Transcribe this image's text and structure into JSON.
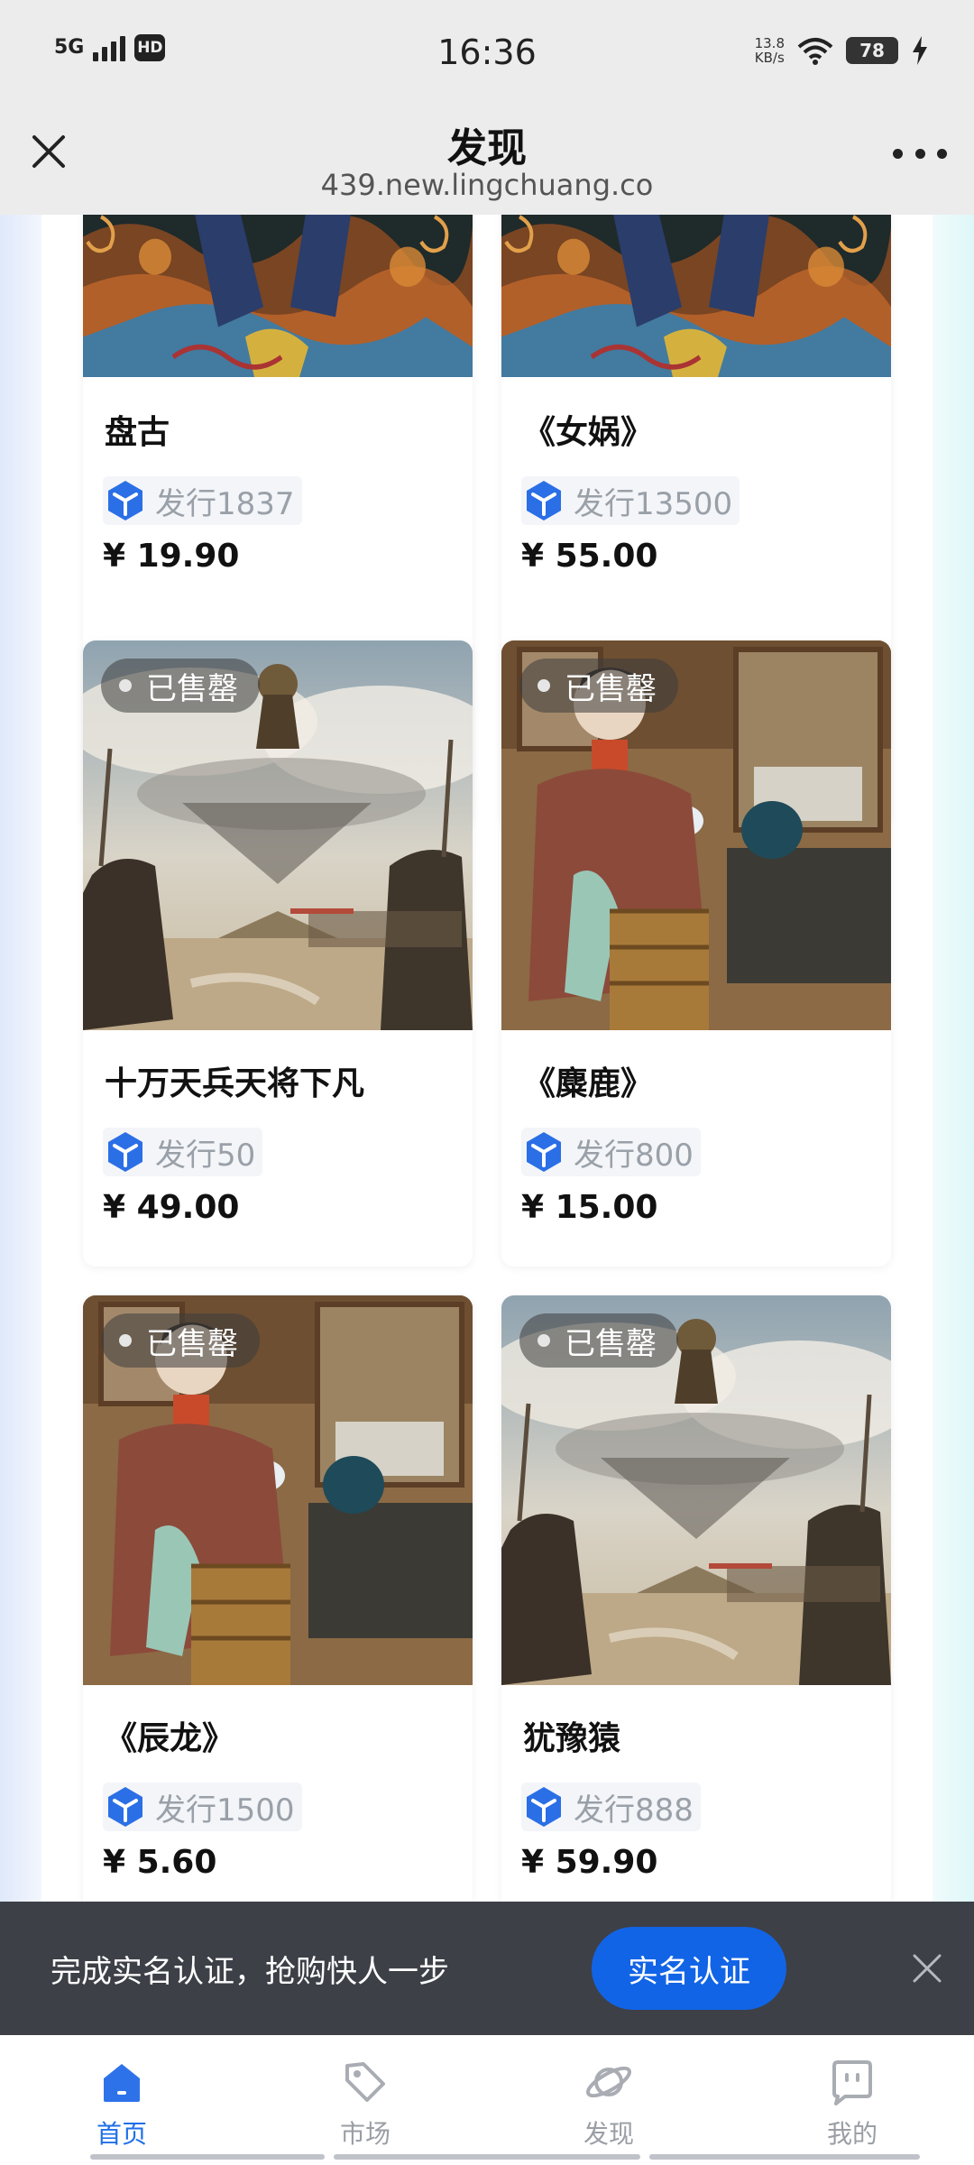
{
  "status_bar": {
    "network": "5G",
    "hd": "HD",
    "time": "16:36",
    "speed_value": "13.8",
    "speed_unit": "KB/s",
    "battery": "78"
  },
  "nav": {
    "title": "发现",
    "url": "439.new.lingchuang.co"
  },
  "cards": [
    {
      "title": "盘古",
      "issue": "发行1837",
      "price": "¥ 19.90",
      "badge": ""
    },
    {
      "title": "《女娲》",
      "issue": "发行13500",
      "price": "¥ 55.00",
      "badge": ""
    },
    {
      "title": "十万天兵天将下凡",
      "issue": "发行50",
      "price": "¥ 49.00",
      "badge": "已售罄"
    },
    {
      "title": "《麋鹿》",
      "issue": "发行800",
      "price": "¥ 15.00",
      "badge": "已售罄"
    },
    {
      "title": "《辰龙》",
      "issue": "发行1500",
      "price": "¥ 5.60",
      "badge": "已售罄"
    },
    {
      "title": "犹豫猿",
      "issue": "发行888",
      "price": "¥ 59.90",
      "badge": "已售罄"
    }
  ],
  "banner": {
    "text": "完成实名认证，抢购快人一步",
    "button": "实名认证"
  },
  "tabs": [
    {
      "label": "首页",
      "icon": "home-icon",
      "active": true
    },
    {
      "label": "市场",
      "icon": "tag-icon",
      "active": false
    },
    {
      "label": "发现",
      "icon": "planet-icon",
      "active": false
    },
    {
      "label": "我的",
      "icon": "profile-chat-icon",
      "active": false
    }
  ],
  "colors": {
    "accent": "#1264e6",
    "tab_active": "#1f6fe8",
    "banner_bg": "#3d4047"
  }
}
